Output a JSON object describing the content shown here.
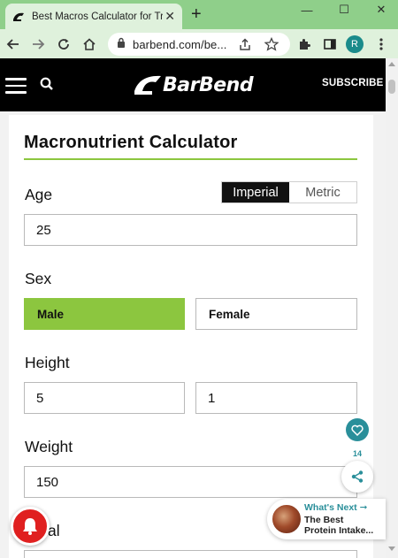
{
  "browser": {
    "tab_title": "Best Macros Calculator for Trai",
    "url": "barbend.com/be...",
    "profile_initial": "R",
    "new_tab_symbol": "+",
    "close_symbol": "✕",
    "min_symbol": "—",
    "max_symbol": "☐"
  },
  "site": {
    "logo_text": "BarBend",
    "subscribe_label": "SUBSCRIBE"
  },
  "calculator": {
    "title": "Macronutrient Calculator",
    "units": {
      "imperial": "Imperial",
      "metric": "Metric",
      "selected": "Imperial"
    },
    "age": {
      "label": "Age",
      "value": "25"
    },
    "sex": {
      "label": "Sex",
      "male": "Male",
      "female": "Female",
      "selected": "Male"
    },
    "height": {
      "label": "Height",
      "feet": "5",
      "inches": "1"
    },
    "weight": {
      "label": "Weight",
      "value": "150"
    },
    "goal": {
      "label_partial": "al"
    }
  },
  "widgets": {
    "like_count": "14",
    "whats_next_label": "What's Next ➞",
    "whats_next_title_line1": "The Best",
    "whats_next_title_line2": "Protein Intake..."
  },
  "colors": {
    "accent_green": "#8cc63f",
    "teal": "#2a8f9a",
    "header_black": "#000000",
    "notification_red": "#e02020",
    "chrome_green": "#8fcf8a"
  }
}
